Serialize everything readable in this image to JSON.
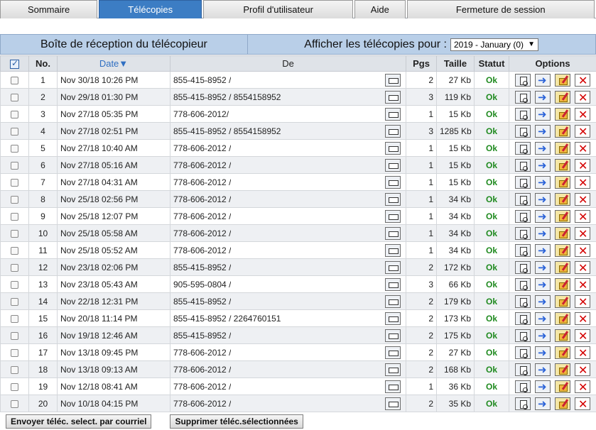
{
  "nav": {
    "tabs": [
      {
        "label": "Sommaire",
        "w": 138
      },
      {
        "label": "Télécopies",
        "w": 146,
        "active": true
      },
      {
        "label": "Profil d'utilisateur",
        "w": 212
      },
      {
        "label": "Aide",
        "w": 72
      },
      {
        "label": "Fermeture de session",
        "w": 266
      }
    ]
  },
  "header": {
    "inbox_title": "Boîte de réception du télécopieur",
    "show_label": "Afficher les télécopies pour :",
    "period_value": "2019 - January (0)"
  },
  "table": {
    "columns": {
      "no": "No.",
      "date": "Date",
      "from": "De",
      "pages": "Pgs",
      "size": "Taille",
      "status": "Statut",
      "options": "Options"
    },
    "rows": [
      {
        "no": "1",
        "date": "Nov 30/18 10:26 PM",
        "from": "855-415-8952 /",
        "pages": "2",
        "size": "27 Kb",
        "status": "Ok"
      },
      {
        "no": "2",
        "date": "Nov 29/18 01:30 PM",
        "from": "855-415-8952 / 8554158952",
        "pages": "3",
        "size": "119 Kb",
        "status": "Ok"
      },
      {
        "no": "3",
        "date": "Nov 27/18 05:35 PM",
        "from": "778-606-2012/",
        "pages": "1",
        "size": "15 Kb",
        "status": "Ok"
      },
      {
        "no": "4",
        "date": "Nov 27/18 02:51 PM",
        "from": "855-415-8952 / 8554158952",
        "pages": "3",
        "size": "1285 Kb",
        "status": "Ok"
      },
      {
        "no": "5",
        "date": "Nov 27/18 10:40 AM",
        "from": "778-606-2012 /",
        "pages": "1",
        "size": "15 Kb",
        "status": "Ok"
      },
      {
        "no": "6",
        "date": "Nov 27/18 05:16 AM",
        "from": "778-606-2012 /",
        "pages": "1",
        "size": "15 Kb",
        "status": "Ok"
      },
      {
        "no": "7",
        "date": "Nov 27/18 04:31 AM",
        "from": "778-606-2012 /",
        "pages": "1",
        "size": "15 Kb",
        "status": "Ok"
      },
      {
        "no": "8",
        "date": "Nov 25/18 02:56 PM",
        "from": "778-606-2012 /",
        "pages": "1",
        "size": "34 Kb",
        "status": "Ok"
      },
      {
        "no": "9",
        "date": "Nov 25/18 12:07 PM",
        "from": "778-606-2012 /",
        "pages": "1",
        "size": "34 Kb",
        "status": "Ok"
      },
      {
        "no": "10",
        "date": "Nov 25/18 05:58 AM",
        "from": "778-606-2012 /",
        "pages": "1",
        "size": "34 Kb",
        "status": "Ok"
      },
      {
        "no": "11",
        "date": "Nov 25/18 05:52 AM",
        "from": "778-606-2012 /",
        "pages": "1",
        "size": "34 Kb",
        "status": "Ok"
      },
      {
        "no": "12",
        "date": "Nov 23/18 02:06 PM",
        "from": "855-415-8952 /",
        "pages": "2",
        "size": "172 Kb",
        "status": "Ok"
      },
      {
        "no": "13",
        "date": "Nov 23/18 05:43 AM",
        "from": "905-595-0804 /",
        "pages": "3",
        "size": "66 Kb",
        "status": "Ok"
      },
      {
        "no": "14",
        "date": "Nov 22/18 12:31 PM",
        "from": "855-415-8952 /",
        "pages": "2",
        "size": "179 Kb",
        "status": "Ok"
      },
      {
        "no": "15",
        "date": "Nov 20/18 11:14 PM",
        "from": "855-415-8952 / 2264760151",
        "pages": "2",
        "size": "173 Kb",
        "status": "Ok"
      },
      {
        "no": "16",
        "date": "Nov 19/18 12:46 AM",
        "from": "855-415-8952 /",
        "pages": "2",
        "size": "175 Kb",
        "status": "Ok"
      },
      {
        "no": "17",
        "date": "Nov 13/18 09:45 PM",
        "from": "778-606-2012 /",
        "pages": "2",
        "size": "27 Kb",
        "status": "Ok"
      },
      {
        "no": "18",
        "date": "Nov 13/18 09:13 AM",
        "from": "778-606-2012 /",
        "pages": "2",
        "size": "168 Kb",
        "status": "Ok"
      },
      {
        "no": "19",
        "date": "Nov 12/18 08:41 AM",
        "from": "778-606-2012 /",
        "pages": "1",
        "size": "36 Kb",
        "status": "Ok"
      },
      {
        "no": "20",
        "date": "Nov 10/18 04:15 PM",
        "from": "778-606-2012 /",
        "pages": "2",
        "size": "35 Kb",
        "status": "Ok"
      }
    ]
  },
  "footer": {
    "email_button": "Envoyer  téléc. select. par courriel",
    "delete_button": "Supprimer téléc.sélectionnées"
  },
  "colors": {
    "active_tab": "#3c7dc4",
    "header_band": "#b9cfe8",
    "status_ok": "#1f8a1f"
  }
}
